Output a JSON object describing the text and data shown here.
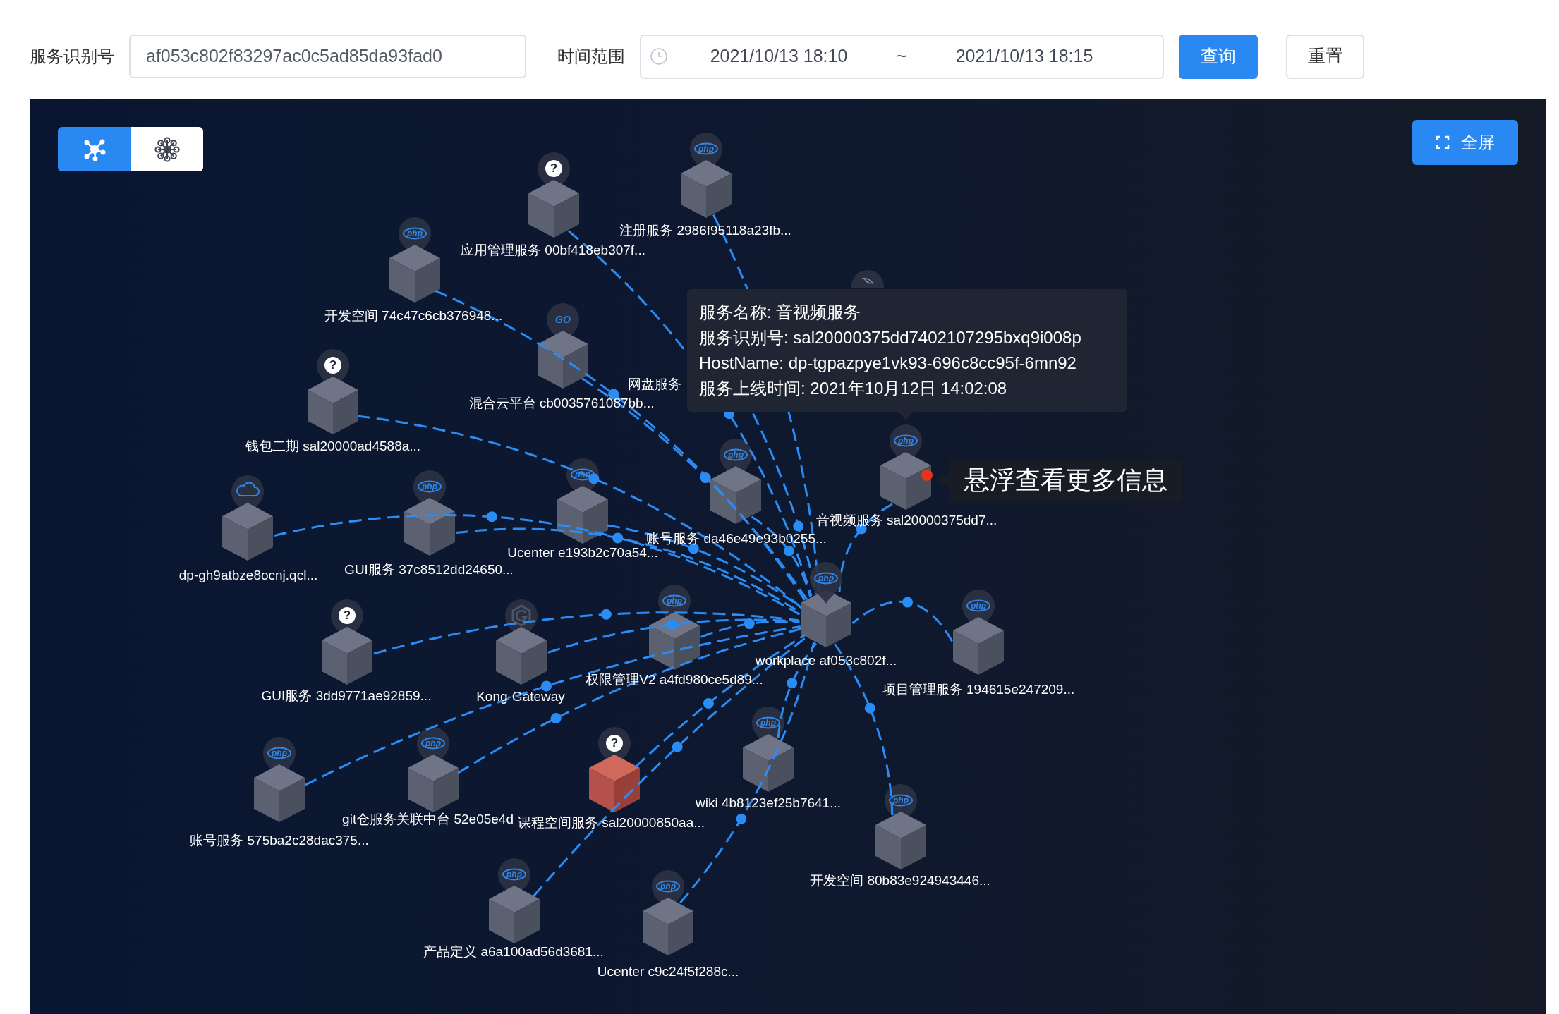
{
  "filters": {
    "service_id": {
      "label": "服务识别号",
      "value": "af053c802f83297ac0c5ad85da93fad0"
    },
    "time_range": {
      "label": "时间范围",
      "start": "2021/10/13 18:10",
      "separator": "~",
      "end": "2021/10/13 18:15"
    },
    "buttons": [
      {
        "label": "查询",
        "kind": "primary"
      },
      {
        "label": "重置",
        "kind": "default"
      }
    ]
  },
  "graph": {
    "view_modes": [
      {
        "kind": "network",
        "selected": true
      },
      {
        "kind": "cluster",
        "selected": false
      }
    ],
    "fullscreen_button": {
      "label": "全屏"
    },
    "center": {
      "label": "workplace af053c802f...",
      "kind": "php",
      "badge": "php",
      "alert": false
    },
    "nodes": [
      {
        "label": "注册服务 2986f95118a23fb...",
        "kind": "php",
        "badge": "php",
        "alert": false
      },
      {
        "label": "应用管理服务 00bf418eb307f...",
        "kind": "unknown",
        "badge": "?",
        "alert": false
      },
      {
        "label": "开发空间 74c47c6cb376948...",
        "kind": "php",
        "badge": "php",
        "alert": false
      },
      {
        "kind": "leaf"
      },
      {
        "label": "混合云平台 cb0035761087bb...",
        "kind": "go",
        "badge": "GO",
        "alert": false
      },
      {
        "label": "网盘服务",
        "kind": "covered"
      },
      {
        "label": "钱包二期 sal20000ad4588a...",
        "kind": "unknown",
        "badge": "?",
        "alert": false
      },
      {
        "label": "音视频服务 sal20000375dd7...",
        "kind": "php",
        "badge": "php",
        "alert": false
      },
      {
        "label": "账号服务 da46e49e93b0255...",
        "kind": "php",
        "badge": "php",
        "alert": false
      },
      {
        "label": "Ucenter e193b2c70a54...",
        "kind": "php",
        "badge": "php",
        "alert": false
      },
      {
        "label": "GUI服务 37c8512dd24650...",
        "kind": "php",
        "badge": "php",
        "alert": false
      },
      {
        "label": "dp-gh9atbze8ocnj.qcl...",
        "kind": "cloud",
        "alert": false
      },
      {
        "label": "权限管理V2 a4fd980ce5d89...",
        "kind": "php",
        "badge": "php",
        "alert": false
      },
      {
        "label": "项目管理服务 194615e247209...",
        "kind": "php",
        "badge": "php",
        "alert": false
      },
      {
        "label": "GUI服务 3dd9771ae92859...",
        "kind": "unknown",
        "badge": "?",
        "alert": false
      },
      {
        "label": "Kong-Gateway",
        "kind": "gateway",
        "alert": false
      },
      {
        "label": "wiki 4b8123ef25b7641...",
        "kind": "php",
        "badge": "php",
        "alert": false
      },
      {
        "label": "git仓服务关联中台 52e05e4d",
        "kind": "php",
        "badge": "php",
        "alert": false
      },
      {
        "label": "课程空间服务 sal20000850aa...",
        "kind": "unknown",
        "badge": "?",
        "alert": true
      },
      {
        "label": "账号服务 575ba2c28dac375...",
        "kind": "php",
        "badge": "php",
        "alert": false
      },
      {
        "label": "开发空间 80b83e924943446...",
        "kind": "php",
        "badge": "php",
        "alert": false
      },
      {
        "label": "产品定义 a6a100ad56d3681...",
        "kind": "php",
        "badge": "php",
        "alert": false
      },
      {
        "label": "Ucenter c9c24f5f288c...",
        "kind": "php",
        "badge": "php",
        "alert": false
      }
    ],
    "tooltip": {
      "lines": [
        "服务名称: 音视频服务",
        "服务识别号: sal20000375dd7402107295bxq9i008p",
        "HostName: dp-tgpazpye1vk93-696c8cc95f-6mn92",
        "服务上线时间: 2021年10月12日 14:02:08"
      ]
    },
    "hint": {
      "text": "悬浮查看更多信息"
    }
  }
}
